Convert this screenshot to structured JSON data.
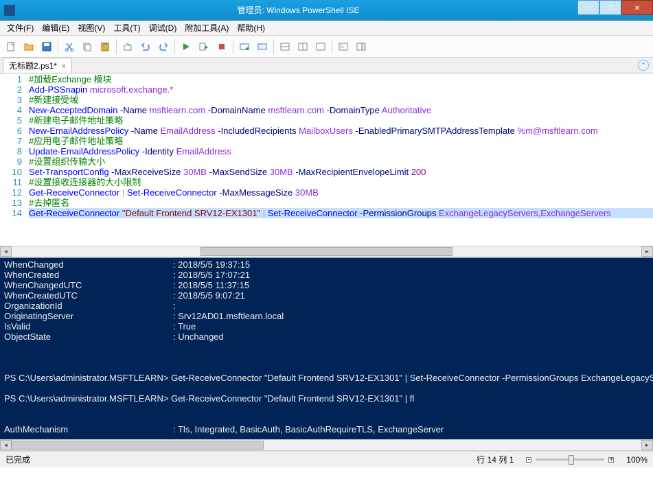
{
  "window": {
    "title": "管理员: Windows PowerShell ISE"
  },
  "menu": {
    "file": "文件(F)",
    "edit": "编辑(E)",
    "view": "视图(V)",
    "tools": "工具(T)",
    "debug": "调试(D)",
    "addons": "附加工具(A)",
    "help": "帮助(H)"
  },
  "tab": {
    "name": "无标题2.ps1*"
  },
  "code": {
    "lines": [
      {
        "n": "1",
        "seg": [
          [
            "comment",
            "#加载Exchange 模块"
          ]
        ]
      },
      {
        "n": "2",
        "seg": [
          [
            "cmd",
            "Add-PSSnapin"
          ],
          [
            "",
            " "
          ],
          [
            "var",
            "microsoft.exchange.*"
          ]
        ]
      },
      {
        "n": "3",
        "seg": [
          [
            "comment",
            "#新建接受域"
          ]
        ]
      },
      {
        "n": "4",
        "seg": [
          [
            "cmd",
            "New-AcceptedDomain"
          ],
          [
            "",
            " "
          ],
          [
            "param",
            "-Name"
          ],
          [
            "",
            " "
          ],
          [
            "var",
            "msftlearn.com"
          ],
          [
            "",
            " "
          ],
          [
            "param",
            "-DomainName"
          ],
          [
            "",
            " "
          ],
          [
            "var",
            "msftlearn.com"
          ],
          [
            "",
            " "
          ],
          [
            "param",
            "-DomainType"
          ],
          [
            "",
            " "
          ],
          [
            "var",
            "Authoritative"
          ]
        ]
      },
      {
        "n": "5",
        "seg": [
          [
            "comment",
            "#新建电子邮件地址策略"
          ]
        ]
      },
      {
        "n": "6",
        "seg": [
          [
            "cmd",
            "New-EmailAddressPolicy"
          ],
          [
            "",
            " "
          ],
          [
            "param",
            "-Name"
          ],
          [
            "",
            " "
          ],
          [
            "var",
            "EmailAddress"
          ],
          [
            "",
            " "
          ],
          [
            "param",
            "-IncludedRecipients"
          ],
          [
            "",
            " "
          ],
          [
            "var",
            "MailboxUsers"
          ],
          [
            "",
            " "
          ],
          [
            "param",
            "-EnabledPrimarySMTPAddressTemplate"
          ],
          [
            "",
            " "
          ],
          [
            "var",
            "%m@msftlearn.com"
          ]
        ]
      },
      {
        "n": "7",
        "seg": [
          [
            "comment",
            "#应用电子邮件地址策略"
          ]
        ]
      },
      {
        "n": "8",
        "seg": [
          [
            "cmd",
            "Update-EmailAddressPolicy"
          ],
          [
            "",
            " "
          ],
          [
            "param",
            "-Identity"
          ],
          [
            "",
            " "
          ],
          [
            "var",
            "EmailAddress"
          ]
        ]
      },
      {
        "n": "9",
        "seg": [
          [
            "comment",
            "#设置组织传输大小"
          ]
        ]
      },
      {
        "n": "10",
        "seg": [
          [
            "cmd",
            "Set-TransportConfig"
          ],
          [
            "",
            " "
          ],
          [
            "param",
            "-MaxReceiveSize"
          ],
          [
            "",
            " "
          ],
          [
            "var",
            "30MB"
          ],
          [
            "",
            " "
          ],
          [
            "param",
            "-MaxSendSize"
          ],
          [
            "",
            " "
          ],
          [
            "var",
            "30MB"
          ],
          [
            "",
            " "
          ],
          [
            "param",
            "-MaxRecipientEnvelopeLimit"
          ],
          [
            "",
            " "
          ],
          [
            "num",
            "200"
          ]
        ]
      },
      {
        "n": "11",
        "seg": [
          [
            "comment",
            "#设置接收连接器的大小限制"
          ]
        ]
      },
      {
        "n": "12",
        "seg": [
          [
            "cmd",
            "Get-ReceiveConnector"
          ],
          [
            "",
            " "
          ],
          [
            "op",
            "|"
          ],
          [
            "",
            " "
          ],
          [
            "cmd",
            "Set-ReceiveConnector"
          ],
          [
            "",
            " "
          ],
          [
            "param",
            "-MaxMessageSize"
          ],
          [
            "",
            " "
          ],
          [
            "var",
            "30MB"
          ]
        ]
      },
      {
        "n": "13",
        "seg": [
          [
            "comment",
            "#去掉匿名"
          ]
        ]
      },
      {
        "n": "14",
        "sel": true,
        "seg": [
          [
            "cmd",
            "Get-ReceiveConnector"
          ],
          [
            "",
            " "
          ],
          [
            "str",
            "\"Default Frontend SRV12-EX1301\""
          ],
          [
            "",
            " "
          ],
          [
            "op",
            "|"
          ],
          [
            "",
            " "
          ],
          [
            "cmd",
            "Set-ReceiveConnector"
          ],
          [
            "",
            " "
          ],
          [
            "param",
            "-PermissionGroups"
          ],
          [
            "",
            " "
          ],
          [
            "var",
            "ExchangeLegacyServers,ExchangeServers"
          ]
        ]
      }
    ]
  },
  "console": {
    "props": [
      {
        "k": "WhenChanged",
        "v": "2018/5/5 19:37:15"
      },
      {
        "k": "WhenCreated",
        "v": "2018/5/5 17:07:21"
      },
      {
        "k": "WhenChangedUTC",
        "v": "2018/5/5 11:37:15"
      },
      {
        "k": "WhenCreatedUTC",
        "v": "2018/5/5 9:07:21"
      },
      {
        "k": "OrganizationId",
        "v": ""
      },
      {
        "k": "OriginatingServer",
        "v": "Srv12AD01.msftlearn.local"
      },
      {
        "k": "IsValid",
        "v": "True"
      },
      {
        "k": "ObjectState",
        "v": "Unchanged"
      }
    ],
    "blank_after_props": 3,
    "prompt1": "PS C:\\Users\\administrator.MSFTLEARN> Get-ReceiveConnector \"Default Frontend SRV12-EX1301\" | Set-ReceiveConnector -PermissionGroups ExchangeLegacyServe",
    "prompt2": "PS C:\\Users\\administrator.MSFTLEARN> Get-ReceiveConnector \"Default Frontend SRV12-EX1301\" | fl",
    "tail": {
      "k": "AuthMechanism",
      "v": "Tls, Integrated, BasicAuth, BasicAuthRequireTLS, ExchangeServer"
    }
  },
  "status": {
    "state": "已完成",
    "pos": "行 14 列 1",
    "zoom": "100%"
  }
}
